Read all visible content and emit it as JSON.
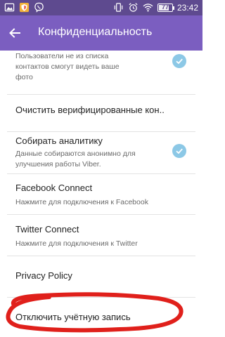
{
  "status_bar": {
    "time": "23:42",
    "battery_level": 0.77,
    "battery_text": "77",
    "left_icons": [
      "image-icon",
      "shield-app-icon",
      "viber-status-icon"
    ],
    "right_icons": [
      "vibrate-icon",
      "alarm-icon",
      "wifi-icon"
    ]
  },
  "app_bar": {
    "title": "Конфиденциальность",
    "back_icon": "arrow-left-icon",
    "background": "#7b5ec0"
  },
  "items": [
    {
      "id": "hidden-contacts",
      "subtitle_lines": [
        "Пользователи не из списка",
        "контактов смогут видеть ваше",
        "фото"
      ],
      "checked": true
    },
    {
      "id": "clear-verified",
      "title": "Очистить верифицированные кон.."
    },
    {
      "id": "analytics",
      "title": "Собирать аналитику",
      "subtitle_lines": [
        "Данные собираются анонимно для",
        "улучшения работы Viber."
      ],
      "checked": true
    },
    {
      "id": "facebook-connect",
      "title": "Facebook Connect",
      "subtitle_lines": [
        "Нажмите для подключения к Facebook"
      ]
    },
    {
      "id": "twitter-connect",
      "title": "Twitter Connect",
      "subtitle_lines": [
        "Нажмите для подключения к Twitter"
      ]
    },
    {
      "id": "privacy-policy",
      "title": "Privacy Policy"
    },
    {
      "id": "deactivate-account",
      "title": "Отключить учётную запись"
    }
  ],
  "colors": {
    "status_bar": "#5e4a8f",
    "accent": "#7b5ec0",
    "check": "#8cc8e6",
    "marker": "#e0201b"
  }
}
